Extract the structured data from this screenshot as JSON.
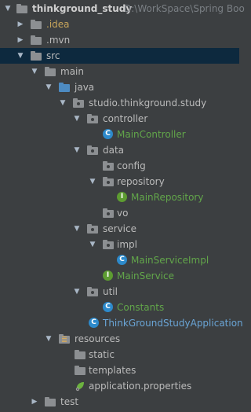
{
  "project": {
    "name": "thinkground_study",
    "path": "D:\\WorkSpace\\Spring Boo"
  },
  "tree": {
    "idea": ".idea",
    "mvn": ".mvn",
    "src": "src",
    "main": "main",
    "java": "java",
    "package": "studio.thinkground.study",
    "controller": "controller",
    "main_controller": "MainController",
    "data": "data",
    "config": "config",
    "repository": "repository",
    "main_repository": "MainRepository",
    "vo": "vo",
    "service": "service",
    "impl": "impl",
    "main_service_impl": "MainServiceImpl",
    "main_service": "MainService",
    "util": "util",
    "constants": "Constants",
    "app_class": "ThinkGroundStudyApplication",
    "resources": "resources",
    "static": "static",
    "templates": "templates",
    "app_properties": "application.properties",
    "test": "test"
  },
  "icon_letters": {
    "class": "C",
    "interface": "I"
  },
  "colors": {
    "background": "#3c3f41",
    "selection": "#0d293e",
    "text": "#bbbbbb",
    "muted": "#7a7f84",
    "idea_folder": "#c7a55b",
    "class_link": "#62a64a",
    "class_icon": "#2d8acb",
    "interface_icon": "#5d9c31"
  }
}
